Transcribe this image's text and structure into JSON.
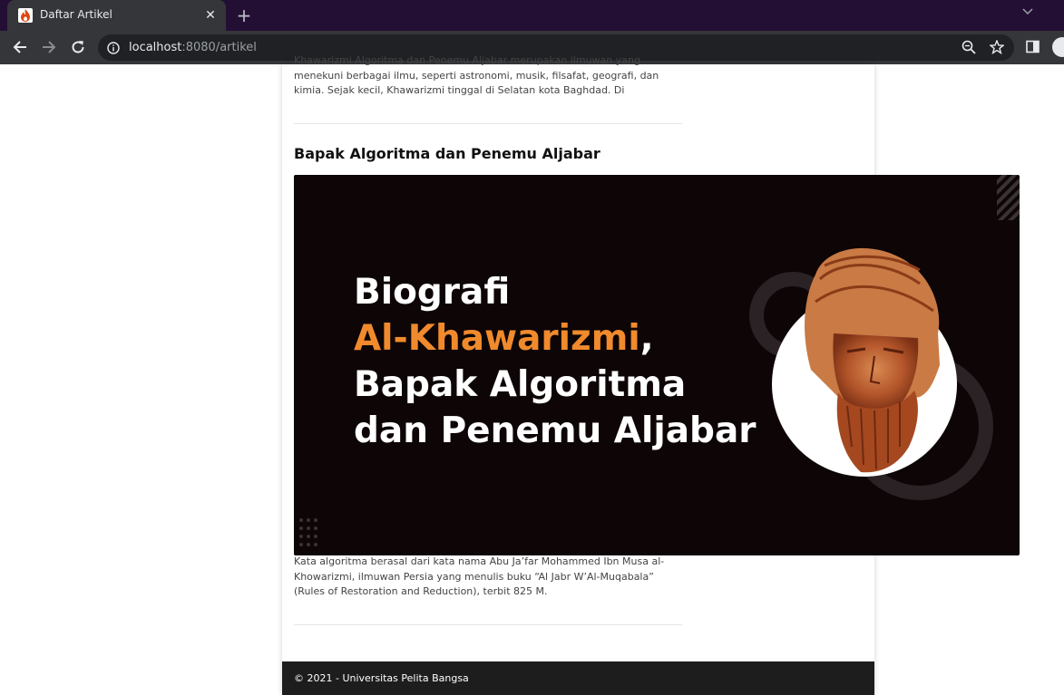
{
  "browser": {
    "tab_title": "Daftar Artikel",
    "url_host": "localhost",
    "url_rest": ":8080/artikel"
  },
  "article_top": {
    "text": "Khawarizmi Algoritma dan Penemu Aljabar merupakan ilmuwan yang menekuni berbagai ilmu, seperti astronomi, musik, filsafat, geografi, dan kimia. Sejak kecil, Khawarizmi tinggal di Selatan kota Baghdad. Di"
  },
  "article": {
    "title": "Bapak Algoritma dan Penemu Aljabar",
    "image": {
      "line1": "Biografi",
      "line2_orange": "Al-Khawarizmi",
      "line2_suffix": ",",
      "line3": "Bapak Algoritma",
      "line4": "dan Penemu Aljabar"
    },
    "body": "Kata algoritma berasal dari kata nama Abu Ja’far Mohammed Ibn Musa al-Khowarizmi, ilmuwan Persia yang menulis buku “Al Jabr W’Al-Muqabala” (Rules of Restoration and Reduction), terbit 825 M."
  },
  "footer": {
    "text": "© 2021 - Universitas Pelita Bangsa"
  },
  "colors": {
    "tabbar": "#240f34",
    "toolbar": "#35363a",
    "banner_bg": "#0d0506",
    "banner_accent": "#f08a2c",
    "footer_bg": "#1d1d1d"
  }
}
